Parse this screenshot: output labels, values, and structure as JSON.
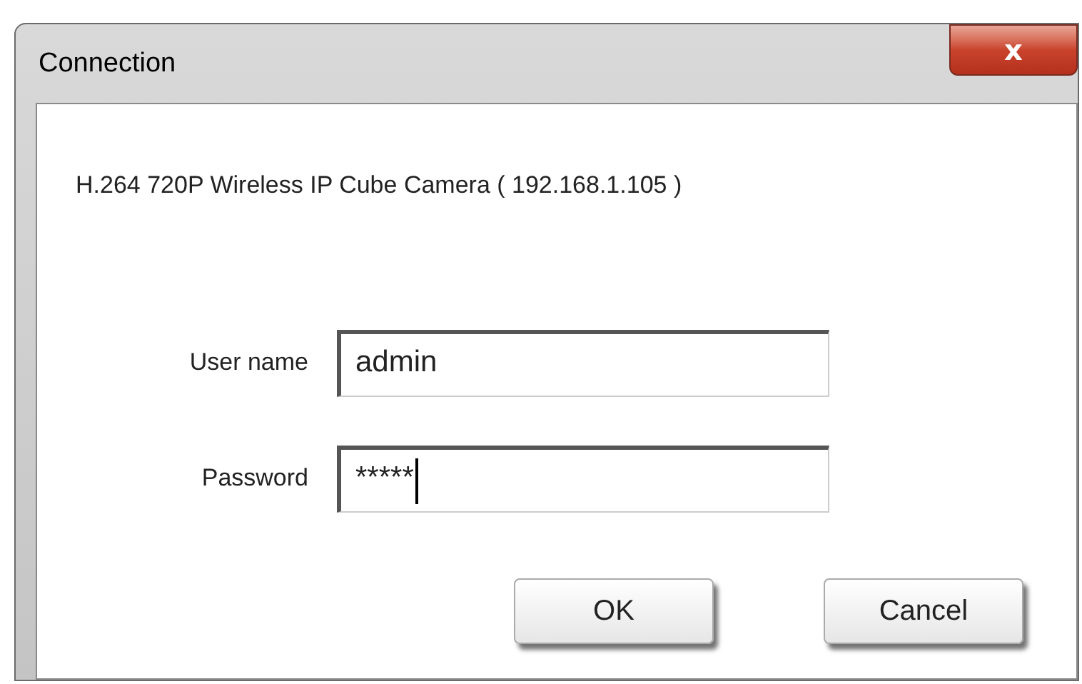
{
  "window": {
    "title": "Connection",
    "close_label": "x"
  },
  "heading": "H.264 720P Wireless IP Cube Camera ( 192.168.1.105 )",
  "fields": [
    {
      "label": "User name",
      "value": "admin",
      "focused": false
    },
    {
      "label": "Password",
      "value": "*****",
      "focused": true
    }
  ],
  "buttons": [
    "OK",
    "Cancel"
  ]
}
